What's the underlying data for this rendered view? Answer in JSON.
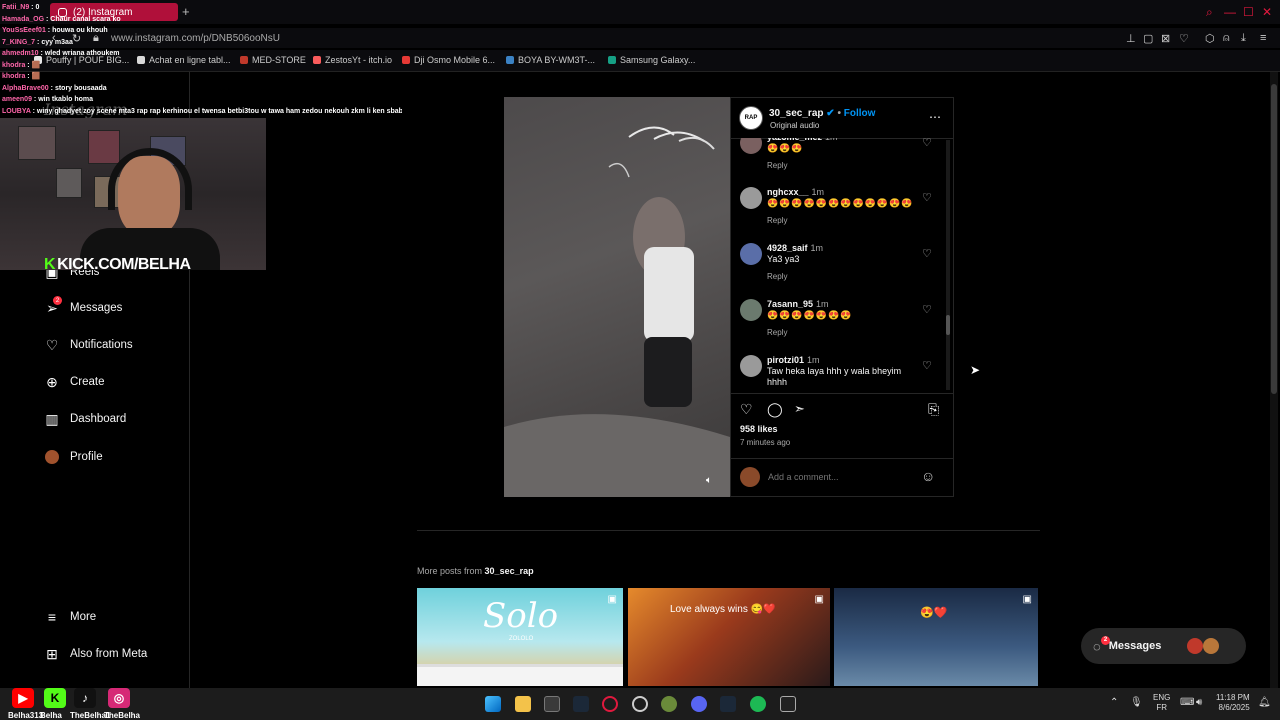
{
  "browser": {
    "tab_title": "(2) Instagram",
    "url": "www.instagram.com/p/DNB506ooNsU",
    "bookmarks": [
      {
        "label": "Pouffy | POUF BIG...",
        "color": "#e8e8e8"
      },
      {
        "label": "Achat en ligne tabl...",
        "color": "#d9d9d9"
      },
      {
        "label": "MED-STORE",
        "color": "#c0392b"
      },
      {
        "label": "ZestosYt - itch.io",
        "color": "#fa5c5c"
      },
      {
        "label": "Dji Osmo Mobile 6...",
        "color": "#e53935"
      },
      {
        "label": "BOYA BY-WM3T-...",
        "color": "#3b82c4"
      },
      {
        "label": "Samsung Galaxy...",
        "color": "#16a085"
      }
    ]
  },
  "chat": [
    {
      "user": "Fatii_N9",
      "msg": "0"
    },
    {
      "user": "Hamada_OG",
      "msg": "Chaûr canal scara ko"
    },
    {
      "user": "YouSsEeef01",
      "msg": "houwa ou khouh"
    },
    {
      "user": "7_KING_7",
      "msg": "cyy m3aa"
    },
    {
      "user": "ahmedm10",
      "msg": "wled wriana athoukem"
    },
    {
      "user": "khodra",
      "msg": "🟫"
    },
    {
      "user": "khodra",
      "msg": "🟫"
    },
    {
      "user": "AlphaBrave00",
      "msg": "story bousaada"
    },
    {
      "user": "ameen09",
      "msg": "win tkablo homa"
    },
    {
      "user": "LOUBYA",
      "msg": "winy ghadyet zoy scene mta3 rap rap kerhinou el twensa betbi3tou w tawa ham zedou nekouh zkm li ken sbab"
    }
  ],
  "stream": {
    "overlay_text": "KICK.COM/BELHA",
    "faded_logo": "Instagram"
  },
  "sidebar": {
    "items": [
      {
        "label": "Reels",
        "icon": "reels-icon"
      },
      {
        "label": "Messages",
        "icon": "messages-icon",
        "badge": "2"
      },
      {
        "label": "Notifications",
        "icon": "heart-icon"
      },
      {
        "label": "Create",
        "icon": "plus-square-icon"
      },
      {
        "label": "Dashboard",
        "icon": "dashboard-icon"
      },
      {
        "label": "Profile",
        "icon": "profile-avatar-icon"
      }
    ],
    "more": "More",
    "also_from_meta": "Also from Meta"
  },
  "post": {
    "author": "30_sec_rap",
    "avatar_text": "30 SEC RAP",
    "follow": "Follow",
    "audio": "Original audio",
    "comments": [
      {
        "user": "yaz3me_mez",
        "time": "1m",
        "text": "😍😍😍",
        "reply": "Reply",
        "avatar_color": "#7a6060"
      },
      {
        "user": "nghcxx__",
        "time": "1m",
        "text": "😍😍😍😍😍😍😍😍😍😍😍😍",
        "reply": "Reply",
        "avatar_color": "#9a9a9a"
      },
      {
        "user": "4928_saif",
        "time": "1m",
        "text": "Ya3 ya3",
        "reply": "Reply",
        "avatar_color": "#5a6ea8"
      },
      {
        "user": "7asann_95",
        "time": "1m",
        "text": "😍😍😍😍😍😍😍",
        "reply": "Reply",
        "avatar_color": "#6b7a6e"
      },
      {
        "user": "pirotzi01",
        "time": "1m",
        "text": "Taw heka laya hhh y wala bheyim hhhh",
        "reply": "",
        "avatar_color": "#9a9a9a"
      }
    ],
    "likes": "958 likes",
    "posted": "7 minutes ago",
    "add_comment_placeholder": "Add a comment..."
  },
  "more_posts": {
    "label_prefix": "More posts from",
    "author": "30_sec_rap",
    "thumbs": [
      {
        "caption": "Solo",
        "sub": "ZOLOLO"
      },
      {
        "caption": "Love always wins 😋❤️",
        "sub": ""
      },
      {
        "caption": "😍❤️",
        "sub": ""
      }
    ]
  },
  "messages_pill": {
    "label": "Messages",
    "badge": "2"
  },
  "social_bar": [
    {
      "name": "youtube",
      "label": "Belha313",
      "color": "#ff0000",
      "glyph": "▶"
    },
    {
      "name": "kick",
      "label": "Belha",
      "color": "#53fc18",
      "glyph": "K"
    },
    {
      "name": "tiktok",
      "label": "TheBelha1",
      "color": "#111111",
      "glyph": "♪"
    },
    {
      "name": "instagram",
      "label": "TheBelha",
      "color": "#d62976",
      "glyph": "◎"
    }
  ],
  "taskbar": {
    "lang_top": "ENG",
    "lang_bottom": "FR",
    "time": "11:18 PM",
    "date": "8/6/2025"
  }
}
